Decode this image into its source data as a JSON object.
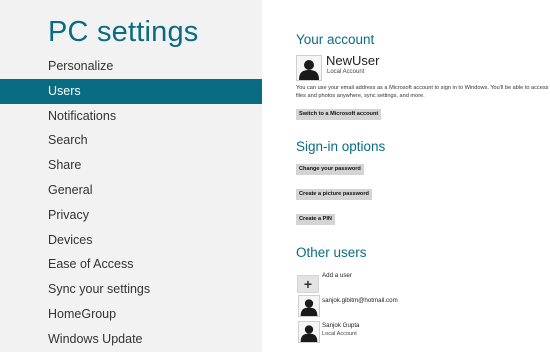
{
  "left": {
    "title": "PC settings",
    "nav": [
      {
        "label": "Personalize"
      },
      {
        "label": "Users"
      },
      {
        "label": "Notifications"
      },
      {
        "label": "Search"
      },
      {
        "label": "Share"
      },
      {
        "label": "General"
      },
      {
        "label": "Privacy"
      },
      {
        "label": "Devices"
      },
      {
        "label": "Ease of Access"
      },
      {
        "label": "Sync your settings"
      },
      {
        "label": "HomeGroup"
      },
      {
        "label": "Windows Update"
      }
    ],
    "active_index": 1
  },
  "account": {
    "heading": "Your account",
    "name": "NewUser",
    "type": "Local Account",
    "description": "You can use your email address as a Microsoft account to sign in to Windows. You'll be able to access files and photos anywhere, sync settings, and more.",
    "switch_button": "Switch to a Microsoft account"
  },
  "signin": {
    "heading": "Sign-in options",
    "change_password": "Change your password",
    "picture_password": "Create a picture password",
    "pin": "Create a PIN"
  },
  "other_users": {
    "heading": "Other users",
    "add_label": "Add a user",
    "users": [
      {
        "name": "sanjok.gibitm@hotmail.com",
        "type": ""
      },
      {
        "name": "Sanjok Gupta",
        "type": "Local Account"
      }
    ]
  },
  "colors": {
    "accent": "#0a6c82",
    "left_bg": "#f2f2f2",
    "button_bg": "#d4d4d4"
  },
  "icons": {
    "avatar": "user-silhouette-icon",
    "add": "plus-icon"
  }
}
